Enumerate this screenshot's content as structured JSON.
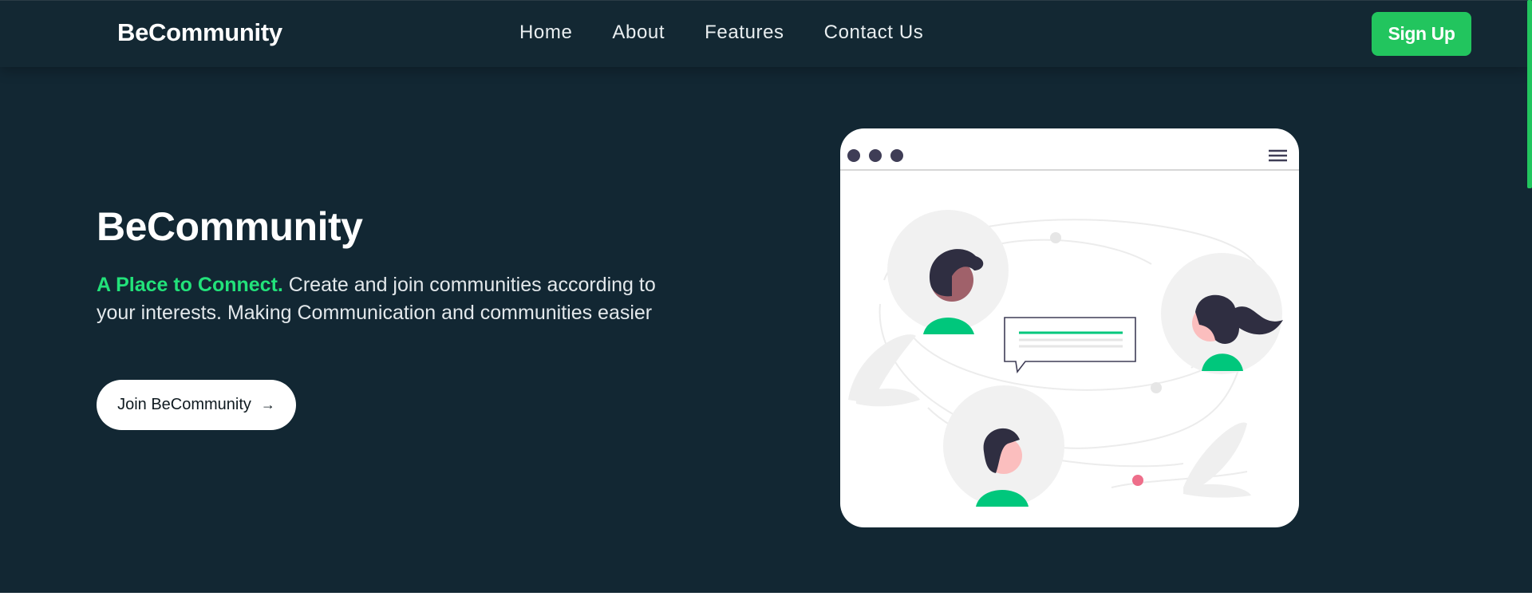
{
  "header": {
    "brand": "BeCommunity",
    "nav": [
      {
        "label": "Home"
      },
      {
        "label": "About"
      },
      {
        "label": "Features"
      },
      {
        "label": "Contact Us"
      }
    ],
    "signup_label": "Sign Up"
  },
  "hero": {
    "title": "BeCommunity",
    "tagline": "A Place to Connect.",
    "description": " Create and join communities according to your interests. Making Communication and communities easier",
    "cta_label": "Join BeCommunity",
    "cta_icon": "arrow-right-icon"
  },
  "colors": {
    "background": "#122733",
    "accent": "#22c55e",
    "tagline": "#22e27a",
    "illustration_dots": "#3f3d56",
    "avatar_shirt": "#00c77c",
    "notification_dot": "#ee6e8a"
  }
}
